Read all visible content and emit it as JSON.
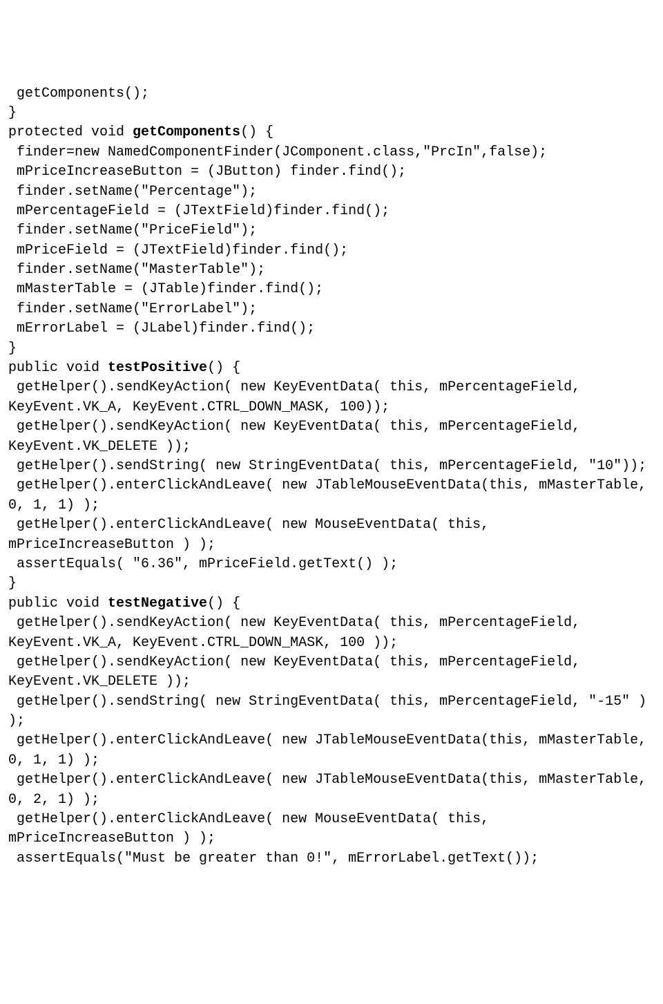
{
  "lines": [
    {
      "indent": 1,
      "parts": [
        {
          "t": "getComponents();"
        }
      ]
    },
    {
      "indent": 0,
      "parts": [
        {
          "t": "}"
        }
      ]
    },
    {
      "indent": 0,
      "parts": [
        {
          "t": "protected void "
        },
        {
          "t": "getComponents",
          "b": true
        },
        {
          "t": "() {"
        }
      ]
    },
    {
      "indent": 1,
      "parts": [
        {
          "t": "finder=new NamedComponentFinder(JComponent.class,\"PrcIn\",false);"
        }
      ]
    },
    {
      "indent": 1,
      "parts": [
        {
          "t": "mPriceIncreaseButton = (JButton) finder.find();"
        }
      ]
    },
    {
      "indent": 1,
      "parts": [
        {
          "t": "finder.setName(\"Percentage\");"
        }
      ]
    },
    {
      "indent": 1,
      "parts": [
        {
          "t": "mPercentageField = (JTextField)finder.find();"
        }
      ]
    },
    {
      "indent": 1,
      "parts": [
        {
          "t": "finder.setName(\"PriceField\");"
        }
      ]
    },
    {
      "indent": 1,
      "parts": [
        {
          "t": "mPriceField = (JTextField)finder.find();"
        }
      ]
    },
    {
      "indent": 1,
      "parts": [
        {
          "t": "finder.setName(\"MasterTable\");"
        }
      ]
    },
    {
      "indent": 1,
      "parts": [
        {
          "t": "mMasterTable = (JTable)finder.find();"
        }
      ]
    },
    {
      "indent": 1,
      "parts": [
        {
          "t": "finder.setName(\"ErrorLabel\");"
        }
      ]
    },
    {
      "indent": 1,
      "parts": [
        {
          "t": "mErrorLabel = (JLabel)finder.find();"
        }
      ]
    },
    {
      "indent": 0,
      "parts": [
        {
          "t": "}"
        }
      ]
    },
    {
      "indent": 0,
      "parts": [
        {
          "t": "public void "
        },
        {
          "t": "testPositive",
          "b": true
        },
        {
          "t": "() {"
        }
      ]
    },
    {
      "indent": 1,
      "parts": [
        {
          "t": "getHelper().sendKeyAction( new KeyEventData( this, mPercentageField, KeyEvent.VK_A, KeyEvent.CTRL_DOWN_MASK, 100));"
        }
      ]
    },
    {
      "indent": 1,
      "parts": [
        {
          "t": "getHelper().sendKeyAction( new KeyEventData( this, mPercentageField, KeyEvent.VK_DELETE ));"
        }
      ]
    },
    {
      "indent": 1,
      "parts": [
        {
          "t": "getHelper().sendString( new StringEventData( this, mPercentageField, \"10\"));"
        }
      ]
    },
    {
      "indent": 1,
      "parts": [
        {
          "t": "getHelper().enterClickAndLeave( new JTableMouseEventData(this, mMasterTable, 0, 1, 1) );"
        }
      ]
    },
    {
      "indent": 1,
      "parts": [
        {
          "t": "getHelper().enterClickAndLeave( new MouseEventData( this, mPriceIncreaseButton ) );"
        }
      ]
    },
    {
      "indent": 1,
      "parts": [
        {
          "t": "assertEquals( \"6.36\", mPriceField.getText() );"
        }
      ]
    },
    {
      "indent": 0,
      "parts": [
        {
          "t": "}"
        }
      ]
    },
    {
      "indent": 0,
      "parts": [
        {
          "t": "public void "
        },
        {
          "t": "testNegative",
          "b": true
        },
        {
          "t": "() {"
        }
      ]
    },
    {
      "indent": 1,
      "parts": [
        {
          "t": "getHelper().sendKeyAction( new KeyEventData( this, mPercentageField, KeyEvent.VK_A, KeyEvent.CTRL_DOWN_MASK, 100 ));"
        }
      ]
    },
    {
      "indent": 1,
      "parts": [
        {
          "t": "getHelper().sendKeyAction( new KeyEventData( this, mPercentageField, KeyEvent.VK_DELETE ));"
        }
      ]
    },
    {
      "indent": 1,
      "parts": [
        {
          "t": "getHelper().sendString( new StringEventData( this, mPercentageField, \"-15\" ) );"
        }
      ]
    },
    {
      "indent": 1,
      "parts": [
        {
          "t": "getHelper().enterClickAndLeave( new JTableMouseEventData(this, mMasterTable, 0, 1, 1) );"
        }
      ]
    },
    {
      "indent": 1,
      "parts": [
        {
          "t": "getHelper().enterClickAndLeave( new JTableMouseEventData(this, mMasterTable, 0, 2, 1) );"
        }
      ]
    },
    {
      "indent": 1,
      "parts": [
        {
          "t": "getHelper().enterClickAndLeave( new MouseEventData( this, mPriceIncreaseButton ) );"
        }
      ]
    },
    {
      "indent": 1,
      "parts": [
        {
          "t": "assertEquals(\"Must be greater than 0!\", mErrorLabel.getText());"
        }
      ]
    }
  ]
}
